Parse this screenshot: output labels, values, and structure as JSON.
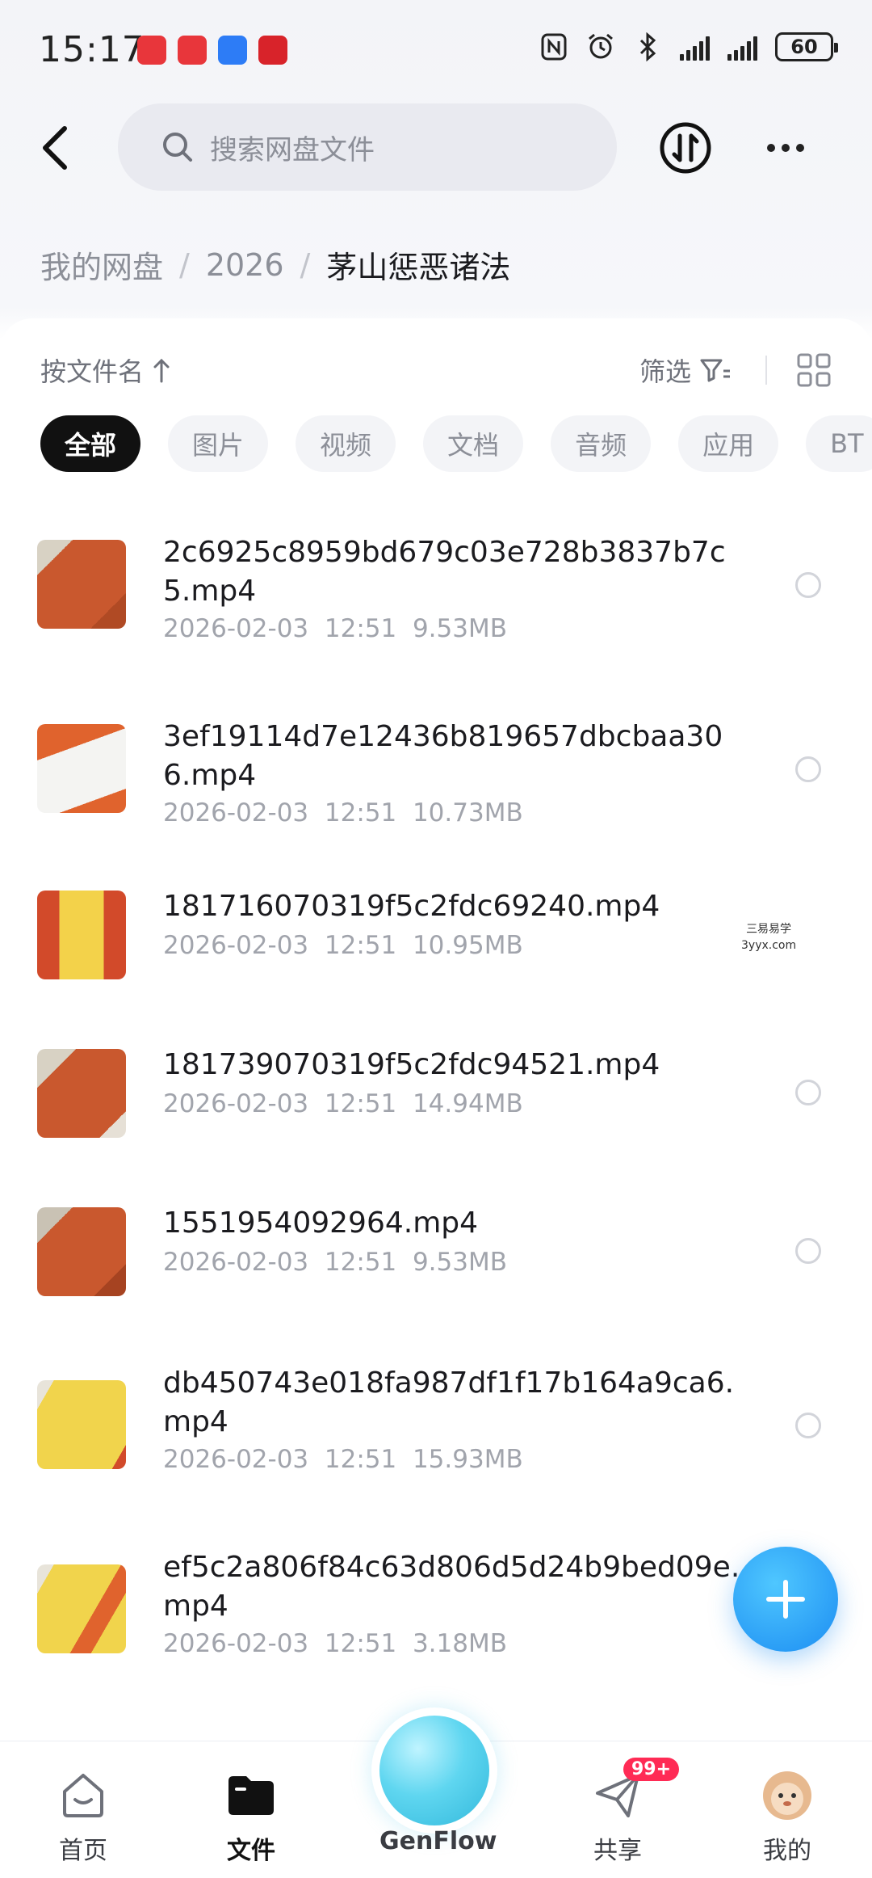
{
  "status_bar": {
    "time": "15:17",
    "battery": "60"
  },
  "header": {
    "search_placeholder": "搜索网盘文件"
  },
  "breadcrumb": {
    "items": [
      "我的网盘",
      "2026"
    ],
    "current": "茅山惩恶诸法"
  },
  "toolbar": {
    "sort_label": "按文件名",
    "filter_label": "筛选"
  },
  "categories": [
    "全部",
    "图片",
    "视频",
    "文档",
    "音频",
    "应用",
    "BT"
  ],
  "files": [
    {
      "name": "2c6925c8959bd679c03e728b3837b7c5.mp4",
      "date": "2026-02-03",
      "time": "12:51",
      "size": "9.53MB"
    },
    {
      "name": "3ef19114d7e12436b819657dbcbaa306.mp4",
      "date": "2026-02-03",
      "time": "12:51",
      "size": "10.73MB"
    },
    {
      "name": "181716070319f5c2fdc69240.mp4",
      "date": "2026-02-03",
      "time": "12:51",
      "size": "10.95MB"
    },
    {
      "name": "181739070319f5c2fdc94521.mp4",
      "date": "2026-02-03",
      "time": "12:51",
      "size": "14.94MB"
    },
    {
      "name": "1551954092964.mp4",
      "date": "2026-02-03",
      "time": "12:51",
      "size": "9.53MB"
    },
    {
      "name": "db450743e018fa987df1f17b164a9ca6.mp4",
      "date": "2026-02-03",
      "time": "12:51",
      "size": "15.93MB"
    },
    {
      "name": "ef5c2a806f84c63d806d5d24b9bed09e.mp4",
      "date": "2026-02-03",
      "time": "12:51",
      "size": "3.18MB"
    }
  ],
  "watermark": {
    "line1": "三易易学",
    "line2": "3yyx.com"
  },
  "bottom_nav": {
    "home": "首页",
    "files": "文件",
    "genflow": "GenFlow",
    "share": "共享",
    "share_badge": "99+",
    "mine": "我的"
  }
}
